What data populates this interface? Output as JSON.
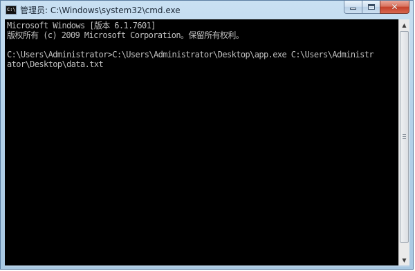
{
  "window": {
    "title": "管理员: C:\\Windows\\system32\\cmd.exe",
    "app_icon_text": "C:\\",
    "controls": {
      "minimize_icon": "minimize-icon",
      "maximize_icon": "maximize-icon",
      "close_glyph": "✕"
    }
  },
  "console": {
    "lines": [
      "Microsoft Windows [版本 6.1.7601]",
      "版权所有 (c) 2009 Microsoft Corporation。保留所有权利。",
      "",
      "C:\\Users\\Administrator>C:\\Users\\Administrator\\Desktop\\app.exe C:\\Users\\Administr",
      "ator\\Desktop\\data.txt"
    ],
    "background": "#000000",
    "foreground": "#c0c0c0"
  },
  "scrollbar": {
    "up_arrow": "▲",
    "down_arrow": "▼"
  }
}
